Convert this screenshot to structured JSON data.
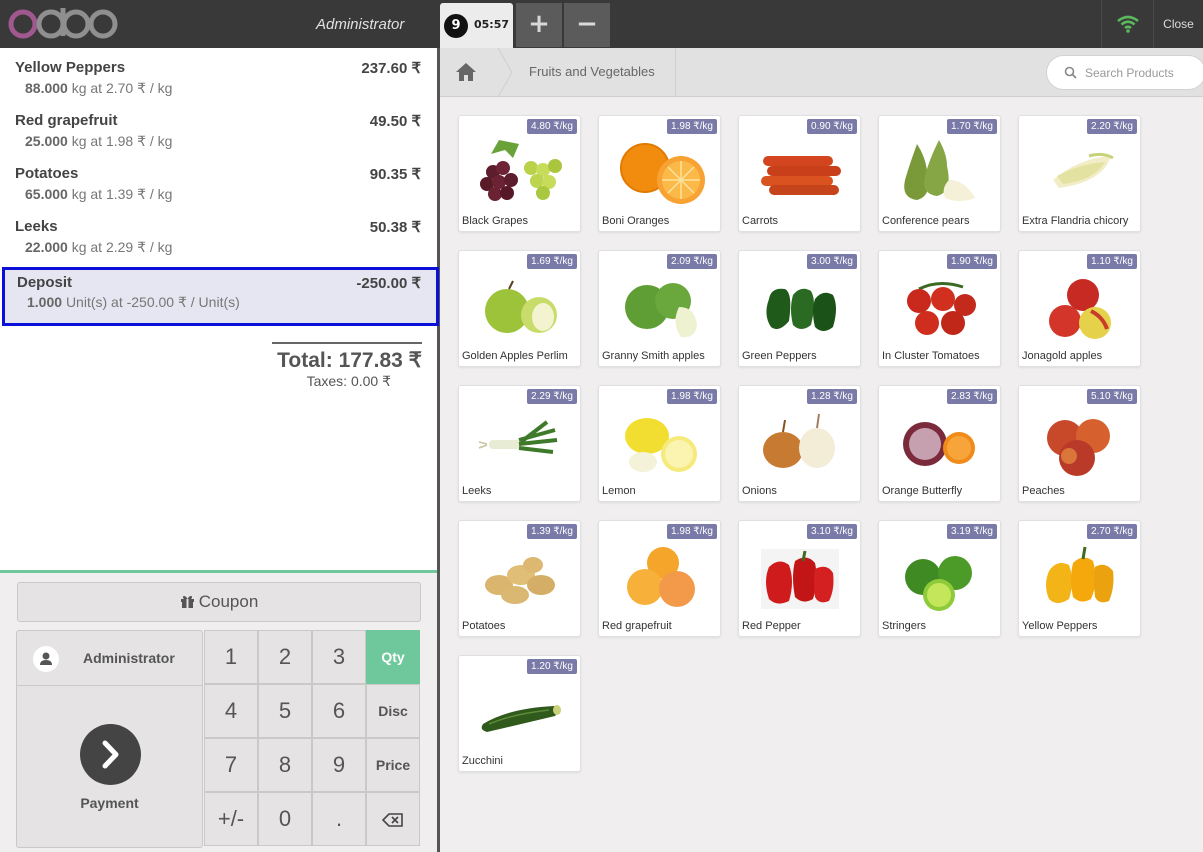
{
  "app": {
    "brand": "odoo"
  },
  "topbar": {
    "cashier": "Administrator",
    "order_number": "9",
    "order_time": "05:57",
    "add_order": "+",
    "remove_order": "−",
    "close": "Close",
    "wifi_color": "#5cb85c"
  },
  "order": {
    "lines": [
      {
        "name": "Yellow Peppers",
        "price": "237.60 ₹",
        "qty": "88.000",
        "detail": "kg at 2.70 ₹ / kg"
      },
      {
        "name": "Red grapefruit",
        "price": "49.50 ₹",
        "qty": "25.000",
        "detail": "kg at 1.98 ₹ / kg"
      },
      {
        "name": "Potatoes",
        "price": "90.35 ₹",
        "qty": "65.000",
        "detail": "kg at 1.39 ₹ / kg"
      },
      {
        "name": "Leeks",
        "price": "50.38 ₹",
        "qty": "22.000",
        "detail": "kg at 2.29 ₹ / kg"
      },
      {
        "name": "Deposit",
        "price": "-250.00 ₹",
        "qty": "1.000",
        "detail": "Unit(s) at -250.00 ₹ / Unit(s)"
      }
    ],
    "total": "Total: 177.83 ₹",
    "taxes": "Taxes: 0.00 ₹"
  },
  "controls": {
    "coupon": "Coupon",
    "customer": "Administrator",
    "payment": "Payment",
    "keys": {
      "k1": "1",
      "k2": "2",
      "k3": "3",
      "qty": "Qty",
      "k4": "4",
      "k5": "5",
      "k6": "6",
      "disc": "Disc",
      "k7": "7",
      "k8": "8",
      "k9": "9",
      "price": "Price",
      "sign": "+/-",
      "k0": "0",
      "dot": "."
    },
    "active_mode": "Qty",
    "accent": "#6ec89b"
  },
  "catalog": {
    "breadcrumb": "Fruits and Vegetables",
    "search_placeholder": "Search Products",
    "products": [
      {
        "name": "Black Grapes",
        "price": "4.80 ₹/kg"
      },
      {
        "name": "Boni Oranges",
        "price": "1.98 ₹/kg"
      },
      {
        "name": "Carrots",
        "price": "0.90 ₹/kg"
      },
      {
        "name": "Conference pears",
        "price": "1.70 ₹/kg"
      },
      {
        "name": "Extra Flandria chicory",
        "price": "2.20 ₹/kg"
      },
      {
        "name": "Golden Apples Perlim",
        "price": "1.69 ₹/kg"
      },
      {
        "name": "Granny Smith apples",
        "price": "2.09 ₹/kg"
      },
      {
        "name": "Green Peppers",
        "price": "3.00 ₹/kg"
      },
      {
        "name": "In Cluster Tomatoes",
        "price": "1.90 ₹/kg"
      },
      {
        "name": "Jonagold apples",
        "price": "1.10 ₹/kg"
      },
      {
        "name": "Leeks",
        "price": "2.29 ₹/kg"
      },
      {
        "name": "Lemon",
        "price": "1.98 ₹/kg"
      },
      {
        "name": "Onions",
        "price": "1.28 ₹/kg"
      },
      {
        "name": "Orange Butterfly",
        "price": "2.83 ₹/kg"
      },
      {
        "name": "Peaches",
        "price": "5.10 ₹/kg"
      },
      {
        "name": "Potatoes",
        "price": "1.39 ₹/kg"
      },
      {
        "name": "Red grapefruit",
        "price": "1.98 ₹/kg"
      },
      {
        "name": "Red Pepper",
        "price": "3.10 ₹/kg"
      },
      {
        "name": "Stringers",
        "price": "3.19 ₹/kg"
      },
      {
        "name": "Yellow Peppers",
        "price": "2.70 ₹/kg"
      },
      {
        "name": "Zucchini",
        "price": "1.20 ₹/kg"
      }
    ]
  }
}
